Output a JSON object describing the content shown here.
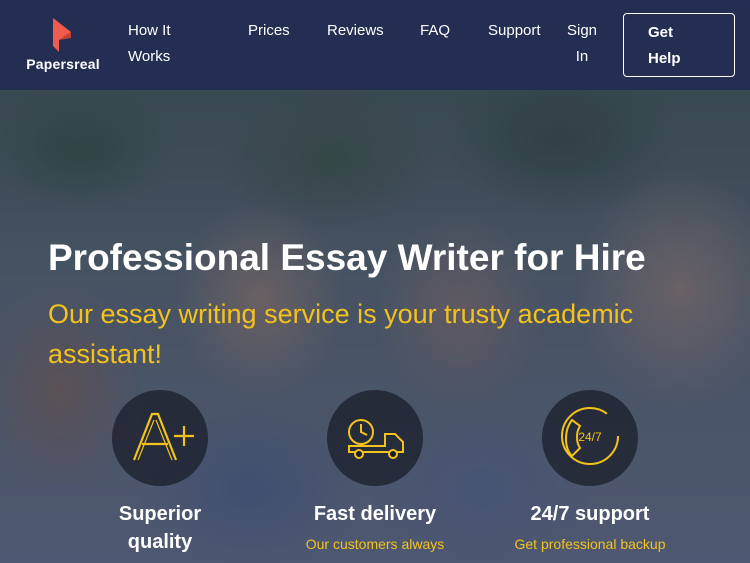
{
  "brand": {
    "name": "Papersreal",
    "accent": "#f05a4f"
  },
  "nav": {
    "items": [
      {
        "label": "How It Works"
      },
      {
        "label": "Prices"
      },
      {
        "label": "Reviews"
      },
      {
        "label": "FAQ"
      },
      {
        "label": "Support"
      },
      {
        "label": "Sign In"
      }
    ],
    "cta_label": "Get Help"
  },
  "hero": {
    "title": "Professional Essay Writer for Hire",
    "subtitle": "Our essay writing service is your trusty academic assistant!",
    "accent_color": "#f4c21d"
  },
  "features": [
    {
      "icon": "a-plus-grade-icon",
      "title": "Superior quality",
      "text": ""
    },
    {
      "icon": "delivery-truck-icon",
      "title": "Fast delivery",
      "text": "Our customers always"
    },
    {
      "icon": "support-24-7-icon",
      "title": "24/7 support",
      "text": "Get professional backup"
    }
  ]
}
